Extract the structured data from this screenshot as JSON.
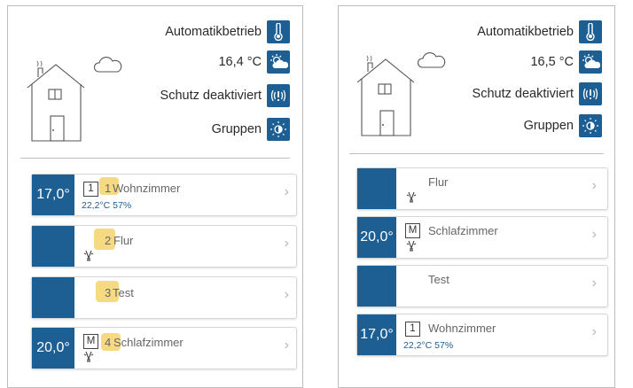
{
  "colors": {
    "accent": "#1d5e93",
    "highlight": "#f5d46b"
  },
  "left": {
    "header": {
      "mode": "Automatikbetrieb",
      "temperature": "16,4 °C",
      "protection": "Schutz deaktiviert",
      "groups": "Gruppen"
    },
    "rooms": [
      {
        "temp": "17,0°",
        "mode": "1",
        "number": "1",
        "name": "Wohnzimmer",
        "humidity": "22,2°C  57%",
        "icon": "chevron-right-icon"
      },
      {
        "temp": "",
        "number": "2",
        "name": "Flur",
        "icon": "bulb-icon"
      },
      {
        "temp": "",
        "number": "3",
        "name": "Test"
      },
      {
        "temp": "20,0°",
        "mode": "M",
        "number": "4",
        "name": "Schlafzimmer",
        "icon": "bulb-icon"
      }
    ],
    "chevron": "›"
  },
  "right": {
    "header": {
      "mode": "Automatikbetrieb",
      "temperature": "16,5 °C",
      "protection": "Schutz deaktiviert",
      "groups": "Gruppen"
    },
    "rooms": [
      {
        "temp": "",
        "name": "Flur",
        "icon": "bulb-icon"
      },
      {
        "temp": "20,0°",
        "mode": "M",
        "name": "Schlafzimmer",
        "icon": "bulb-icon"
      },
      {
        "temp": "",
        "name": "Test"
      },
      {
        "temp": "17,0°",
        "mode": "1",
        "name": "Wohnzimmer",
        "humidity": "22,2°C  57%"
      }
    ],
    "chevron": "›"
  }
}
